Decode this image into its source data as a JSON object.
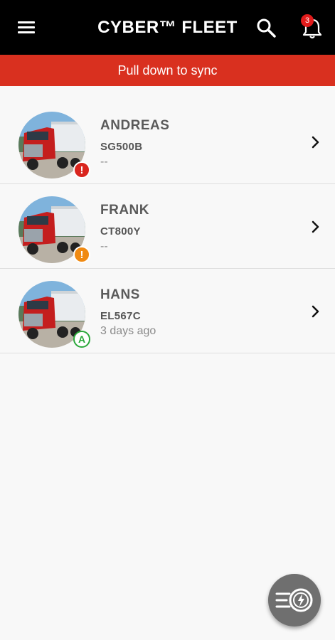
{
  "header": {
    "title": "CYBER™ FLEET",
    "notification_count": "3"
  },
  "banner": {
    "text": "Pull down to sync",
    "color": "#d9301f"
  },
  "vehicles": [
    {
      "name": "ANDREAS",
      "plate": "SG500B",
      "last_seen": "--",
      "status": "alert",
      "status_icon": "!",
      "status_color": "#d9251e"
    },
    {
      "name": "FRANK",
      "plate": "CT800Y",
      "last_seen": "--",
      "status": "warning",
      "status_icon": "!",
      "status_color": "#f08a12"
    },
    {
      "name": "HANS",
      "plate": "EL567C",
      "last_seen": "3 days ago",
      "status": "ok",
      "status_icon": "A",
      "status_color": "#2aa83a"
    }
  ],
  "icons": {
    "menu": "hamburger-menu-icon",
    "search": "search-icon",
    "notifications": "bell-icon",
    "row_arrow": "chevron-right-icon",
    "fab": "speed-menu-icon"
  }
}
